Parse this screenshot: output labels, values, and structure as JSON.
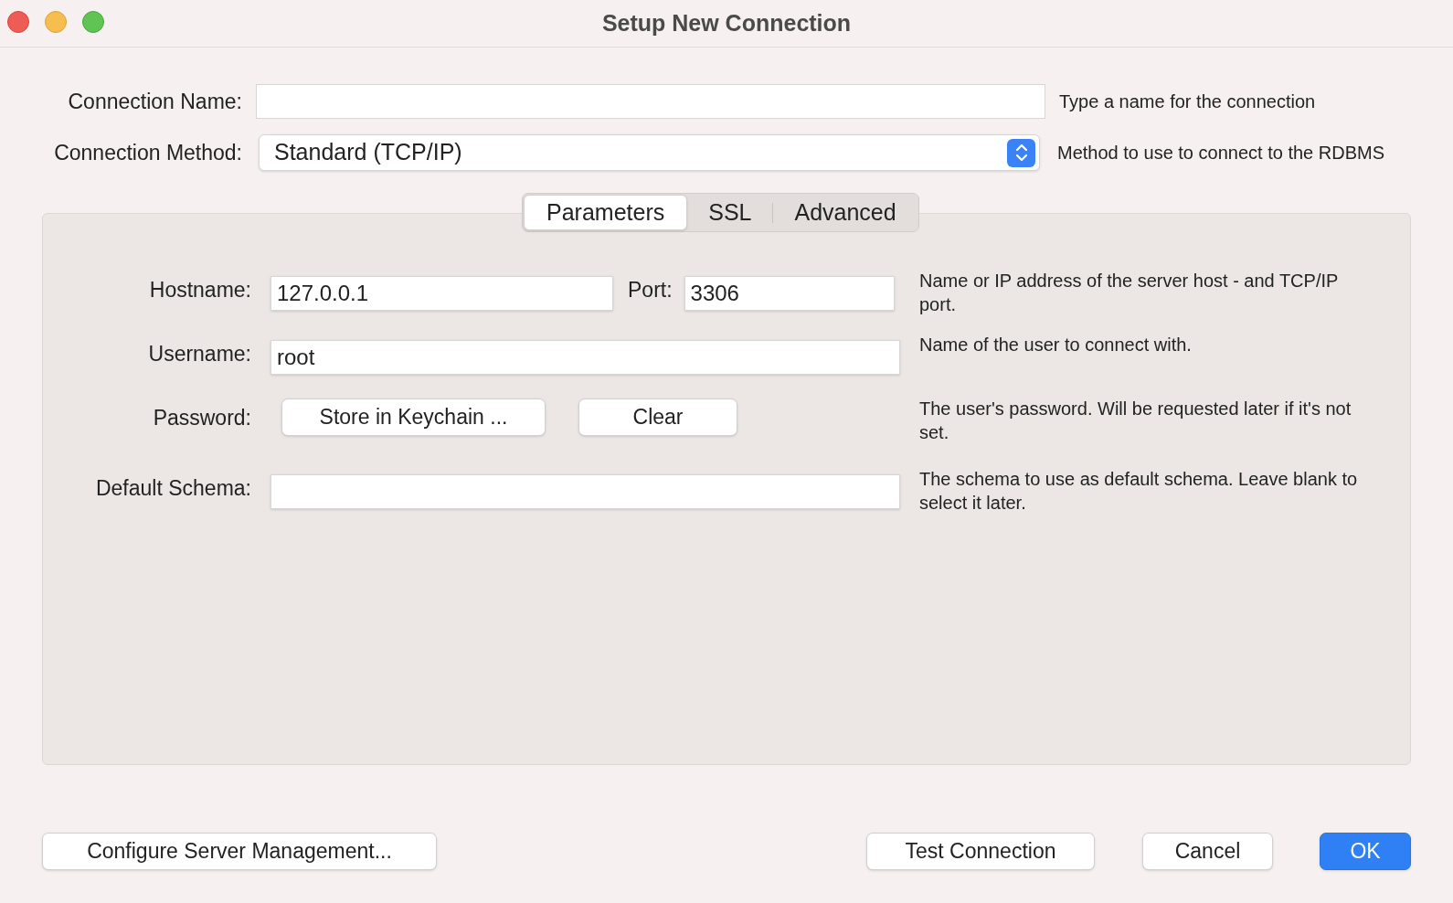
{
  "window": {
    "title": "Setup New Connection"
  },
  "connection_name": {
    "label": "Connection Name:",
    "help": "Type a name for the connection"
  },
  "connection_method": {
    "label": "Connection Method:",
    "value": "Standard (TCP/IP)",
    "help": "Method to use to connect to the RDBMS"
  },
  "tabs": [
    {
      "label": "Parameters",
      "selected": true
    },
    {
      "label": "SSL",
      "selected": false
    },
    {
      "label": "Advanced",
      "selected": false
    }
  ],
  "parameters": [
    {
      "kind": "hostport",
      "label": "Hostname:",
      "value": "127.0.0.1",
      "port_label": "Port:",
      "port_value": "3306",
      "help": "Name or IP address of the server host - and TCP/IP port."
    },
    {
      "kind": "field",
      "label": "Username:",
      "value": "root",
      "help": "Name of the user to connect with."
    },
    {
      "kind": "buttons",
      "label": "Password:",
      "buttons": [
        "Store in Keychain ...",
        "Clear"
      ],
      "help": "The user's password. Will be requested later if it's not set."
    },
    {
      "kind": "field",
      "label": "Default Schema:",
      "help": "The schema to use as default schema. Leave blank to select it later."
    }
  ],
  "left_buttons": [
    "Configure Server Management..."
  ],
  "right_buttons": [
    {
      "label": "Test Connection",
      "default": false
    },
    {
      "label": "Cancel",
      "default": false
    },
    {
      "label": "OK",
      "default": true
    }
  ]
}
